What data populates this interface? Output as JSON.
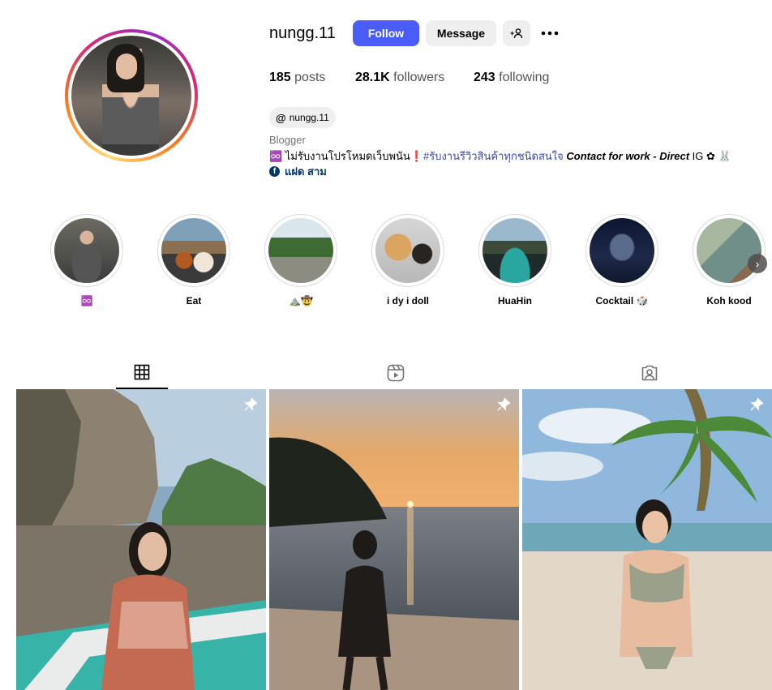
{
  "profile": {
    "username": "nungg.11",
    "follow_label": "Follow",
    "message_label": "Message",
    "add_user_glyph": "+👤",
    "more_glyph": "•••",
    "stats": {
      "posts_count": "185",
      "posts_label": "posts",
      "followers_count": "28.1K",
      "followers_label": "followers",
      "following_count": "243",
      "following_label": "following"
    },
    "threads_handle": "nungg.11",
    "threads_glyph": "@",
    "category": "Blogger",
    "bio_prefix": "♾️ ไม่รับงานโปรโหมดเว็บพนัน❗",
    "bio_tag": "#รับงานรีวิวสินค้าทุกชนิดสนใจ",
    "bio_contact": " Contact for work - Direct",
    "bio_suffix": " IG ✿ 🐰",
    "link_text": "แฝด สาม",
    "link_glyph": "f"
  },
  "highlights": [
    {
      "label": "♾️",
      "icon": "photo-highlight"
    },
    {
      "label": "Eat",
      "icon": "photo-highlight"
    },
    {
      "label": "⛰️🤠",
      "icon": "photo-highlight"
    },
    {
      "label": "i dy i doll",
      "icon": "photo-highlight"
    },
    {
      "label": "HuaHin",
      "icon": "photo-highlight"
    },
    {
      "label": "Cocktail 🎲",
      "icon": "photo-highlight"
    },
    {
      "label": "Koh kood",
      "icon": "photo-highlight"
    }
  ],
  "highlights_next_glyph": "›",
  "tabs": [
    {
      "name": "posts",
      "icon": "grid-icon",
      "active": true
    },
    {
      "name": "reels",
      "icon": "reels-icon",
      "active": false
    },
    {
      "name": "tagged",
      "icon": "tagged-icon",
      "active": false
    }
  ],
  "posts": [
    {
      "pinned": true,
      "scene": "boat-cliffs"
    },
    {
      "pinned": true,
      "scene": "sunset-beach"
    },
    {
      "pinned": true,
      "scene": "palm-beach"
    }
  ],
  "colors": {
    "follow_button": "#4a5df9",
    "secondary_button": "#efefef",
    "link": "#00376b",
    "hashtag": "#3d4a9e"
  }
}
